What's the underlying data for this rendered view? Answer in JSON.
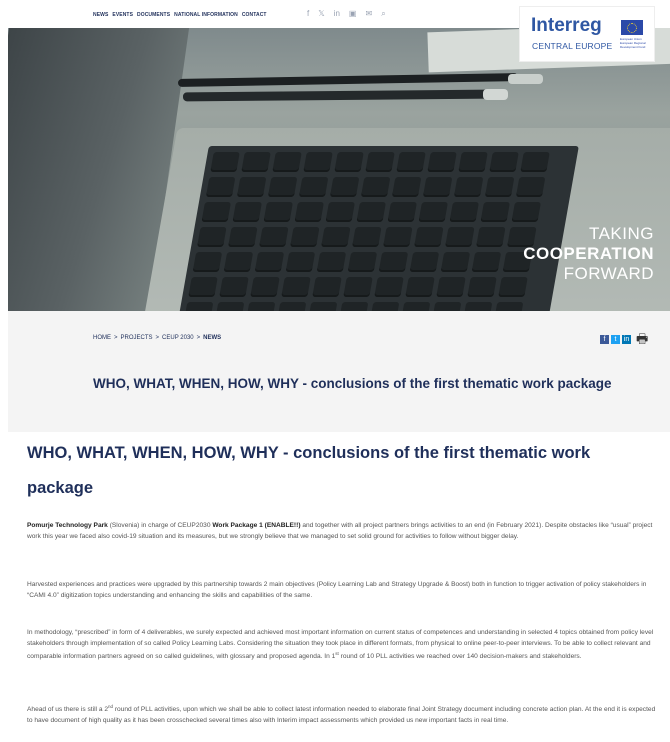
{
  "nav": {
    "items": [
      "NEWS",
      "EVENTS",
      "DOCUMENTS",
      "NATIONAL INFORMATION",
      "CONTACT"
    ],
    "social_icons": [
      "facebook-icon",
      "twitter-icon",
      "linkedin-icon",
      "youtube-icon",
      "newsletter-icon",
      "search-icon"
    ],
    "social_glyphs": [
      "f",
      "𝕏",
      "in",
      "▣",
      "✉",
      "⌕"
    ]
  },
  "logo": {
    "word": "Interreg",
    "sub": "CENTRAL EUROPE",
    "eu_text": "European Union European Regional Development Fund"
  },
  "hero": {
    "line1": "TAKING",
    "line2": "COOPERATION",
    "line3": "FORWARD"
  },
  "breadcrumb": {
    "home": "HOME",
    "projects": "PROJECTS",
    "project": "CEUP 2030",
    "current": "NEWS",
    "sep": ">"
  },
  "share": {
    "facebook": "f",
    "twitter": "t",
    "linkedin": "in",
    "print_icon": "🖶"
  },
  "colors": {
    "brand_navy": "#1f2f5a",
    "interreg_blue": "#2f57a3",
    "facebook": "#3b5998",
    "twitter": "#1da1f2",
    "linkedin": "#0077b5"
  },
  "article": {
    "title": "WHO, WHAT, WHEN, HOW, WHY - conclusions of the first thematic work package",
    "p1_org": "Pomurje Technology Park",
    "p1_a": " (Slovenia) in charge of CEUP2030 ",
    "p1_wp": "Work Package 1 (ENABLE!!)",
    "p1_b": " and together with all project partners brings activities to an end (in February 2021). Despite obstacles like “usual” project work this year we faced also covid-19 situation and its measures, but we strongly believe that we managed to set solid ground for activities to follow without bigger delay.",
    "p2": "Harvested experiences and practices were upgraded by this partnership towards 2 main objectives (Policy Learning Lab and Strategy Upgrade & Boost) both in function to trigger activation of policy stakeholders in “CAMI 4.0” digitization topics understanding and enhancing the skills and capabilities of the same.",
    "p3_a": "In methodology, “prescribed” in form of 4 deliverables, we surely expected and achieved most important information on current status of competences and understanding in selected 4 topics obtained from policy level stakeholders through implementation of so called Policy Learning Labs. Considering the situation they took place in different formats, from physical to online peer-to-peer interviews. To be able to collect relevant and comparable information partners agreed on so called guidelines, with glossary and proposed agenda. In 1",
    "p3_sup": "st",
    "p3_b": " round of 10 PLL activities we reached over 140 decision-makers and stakeholders.",
    "p4_a": "Ahead of us there is still a 2",
    "p4_sup": "nd",
    "p4_b": " round of PLL activities, upon which we shall be able to collect latest information needed to elaborate final Joint Strategy document including concrete action plan. At the end it is expected to have document of high quality as it has been crosschecked several times also with Interim impact assessments which provided us new important facts in real time."
  }
}
